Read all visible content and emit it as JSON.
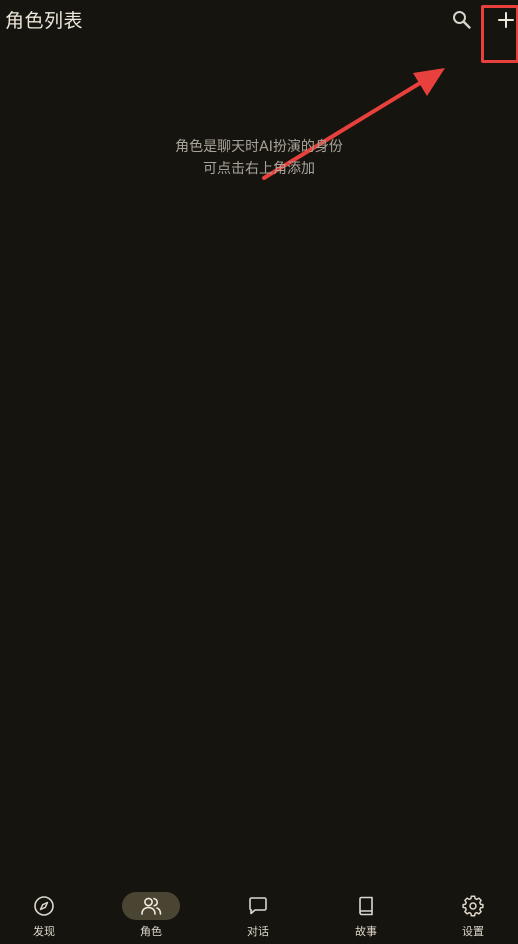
{
  "header": {
    "title": "角色列表",
    "search_icon": "search-icon",
    "add_icon": "plus-icon"
  },
  "empty_state": {
    "line1": "角色是聊天时AI扮演的身份",
    "line2": "可点击右上角添加"
  },
  "annotation": {
    "color": "#e8403c"
  },
  "bottom_nav": {
    "items": [
      {
        "label": "发现",
        "icon": "compass-icon",
        "active": false
      },
      {
        "label": "角色",
        "icon": "users-icon",
        "active": true
      },
      {
        "label": "对话",
        "icon": "chat-bubble-icon",
        "active": false
      },
      {
        "label": "故事",
        "icon": "book-icon",
        "active": false
      },
      {
        "label": "设置",
        "icon": "gear-icon",
        "active": false
      }
    ]
  },
  "colors": {
    "background": "#16140e",
    "active_pill": "#4a4433",
    "text_primary": "#ece7da",
    "text_secondary": "#a9a49a"
  }
}
